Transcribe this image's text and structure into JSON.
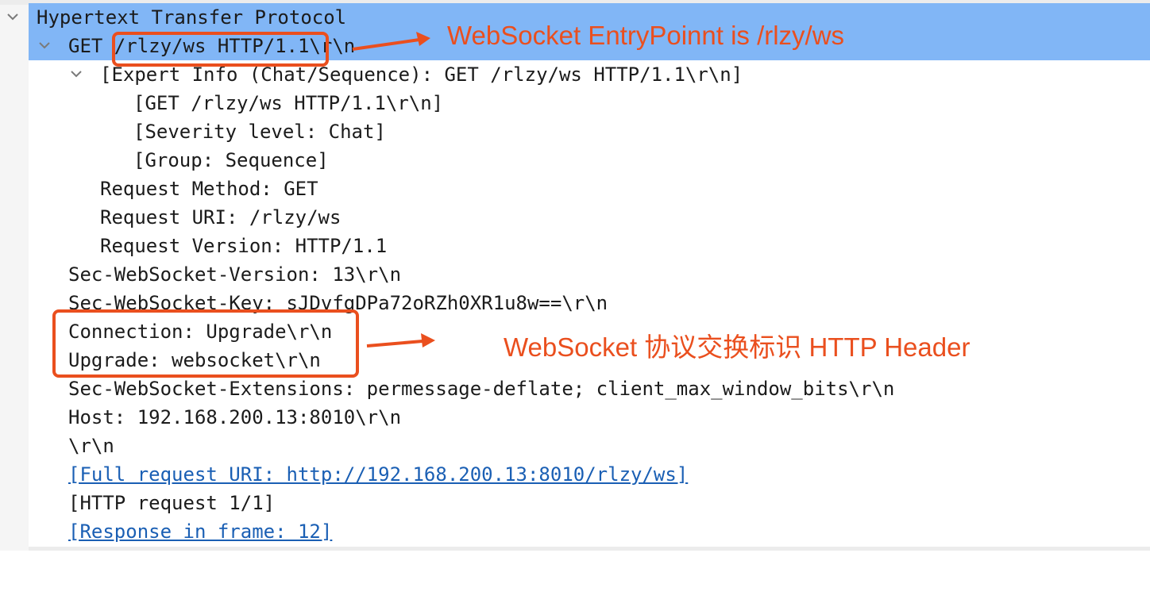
{
  "tree": {
    "root": {
      "label": "Hypertext Transfer Protocol"
    },
    "request_line": {
      "label": "GET /rlzy/ws HTTP/1.1\\r\\n"
    },
    "expert_info": {
      "label": "[Expert Info (Chat/Sequence): GET /rlzy/ws HTTP/1.1\\r\\n]"
    },
    "expert_children": [
      "[GET /rlzy/ws HTTP/1.1\\r\\n]",
      "[Severity level: Chat]",
      "[Group: Sequence]"
    ],
    "request_fields": [
      "Request Method: GET",
      "Request URI: /rlzy/ws",
      "Request Version: HTTP/1.1"
    ],
    "headers": [
      "Sec-WebSocket-Version: 13\\r\\n",
      "Sec-WebSocket-Key: sJDvfgDPa72oRZh0XR1u8w==\\r\\n",
      "Connection: Upgrade\\r\\n",
      "Upgrade: websocket\\r\\n",
      "Sec-WebSocket-Extensions: permessage-deflate; client_max_window_bits\\r\\n",
      "Host: 192.168.200.13:8010\\r\\n",
      "\\r\\n"
    ],
    "full_uri_link": "[Full request URI: http://192.168.200.13:8010/rlzy/ws]",
    "http_request": "[HTTP request 1/1]",
    "response_link": "[Response in frame: 12]"
  },
  "annotations": {
    "entrypoint": "WebSocket EntryPoinnt is /rlzy/ws",
    "header_note": "WebSocket 协议交换标识 HTTP Header"
  },
  "colors": {
    "selection": "#81b6f6",
    "annotation": "#ea4f1e",
    "link": "#1a5fb4"
  },
  "icons": {
    "expand": "chevron-down-icon"
  }
}
